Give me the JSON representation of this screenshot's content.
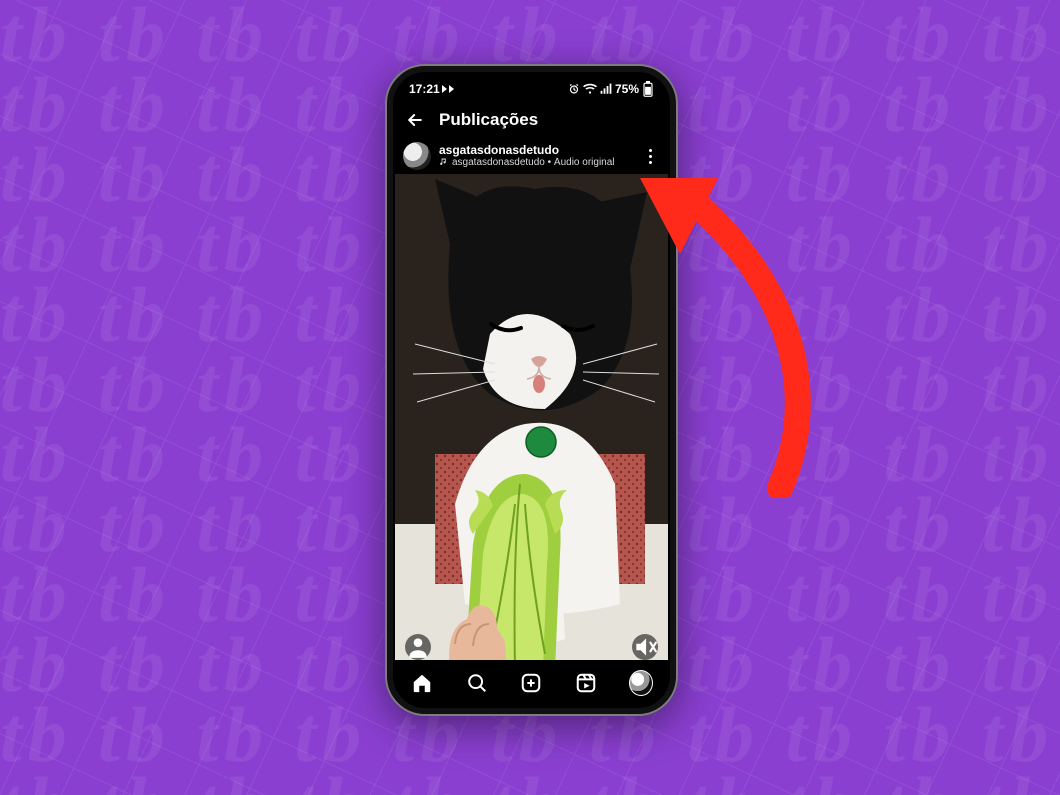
{
  "background": {
    "color": "#8a3fd1",
    "watermark_text": "tb"
  },
  "annotation": {
    "kind": "arrow",
    "color": "#ff2a1a",
    "points_to": "more-options-button"
  },
  "status_bar": {
    "time": "17:21",
    "left_icons": [
      "play-icon",
      "play-icon"
    ],
    "right_icons": [
      "alarm-icon",
      "wifi-icon",
      "signal-icon"
    ],
    "battery_text": "75%"
  },
  "appbar": {
    "title": "Publicações"
  },
  "post": {
    "username": "asgatasdonasdetudo",
    "audio_line": "asgatasdonasdetudo • Áudio original",
    "overlay_buttons": {
      "bottom_left": "tagged-people-icon",
      "bottom_right": "mute-icon"
    },
    "media_description": "Vídeo de um gato preto-e-branco sendo oferecido uma folha de alface; o gato usa uma plaquinha verde no pescoço."
  },
  "tabbar": {
    "items": [
      "home-icon",
      "search-icon",
      "add-post-icon",
      "reels-icon",
      "profile-avatar"
    ]
  }
}
